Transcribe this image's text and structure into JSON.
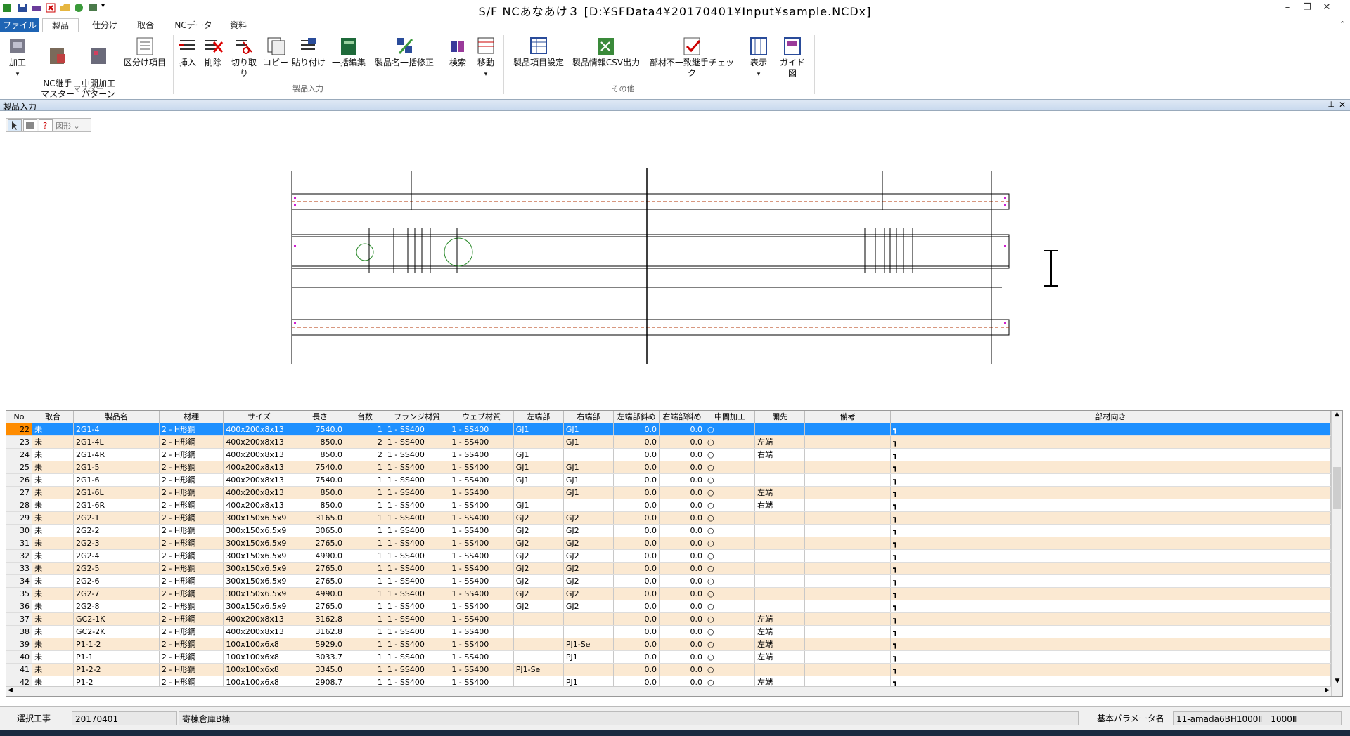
{
  "window": {
    "title": "S/F NCあなあけ３ [D:¥SFData4¥20170401¥Input¥sample.NCDx]"
  },
  "tabs": [
    {
      "label": "ファイル"
    },
    {
      "label": "製品"
    },
    {
      "label": "仕分け"
    },
    {
      "label": "取合"
    },
    {
      "label": "NCデータ"
    },
    {
      "label": "資料"
    }
  ],
  "ribbon": {
    "buttons": {
      "kako": "加工",
      "nc_tsugite": "NC継手\nマスター",
      "chukan": "中間加工\nパターン",
      "kubun": "区分け項目",
      "sounyu": "挿入",
      "sakujo": "削除",
      "kiritori": "切り取り",
      "copy": "コピー",
      "haritsuke": "貼り付け",
      "ikkatsu": "一括編集",
      "seihinmei": "製品名一括修正",
      "kensaku": "検索",
      "idou": "移動",
      "koumoku": "製品項目設定",
      "csv": "製品情報CSV出力",
      "buzai": "部材不一致継手チェック",
      "hyouji": "表示",
      "guide": "ガイド図"
    },
    "groups": {
      "master": "マスター",
      "seihin_nyuryoku": "製品入力",
      "sonota": "その他"
    }
  },
  "panel": {
    "title": "製品入力",
    "shape_dropdown": "図形"
  },
  "table": {
    "headers": [
      "No",
      "取合",
      "製品名",
      "材種",
      "サイズ",
      "長さ",
      "台数",
      "フランジ材質",
      "ウェブ材質",
      "左端部",
      "右端部",
      "左端部斜め",
      "右端部斜め",
      "中間加工",
      "開先",
      "備考",
      "部材向き"
    ],
    "rows": [
      [
        "22",
        "未",
        "2G1-4",
        "2 - H形鋼",
        "400x200x8x13",
        "7540.0",
        "1",
        "1 - SS400",
        "1 - SS400",
        "GJ1",
        "GJ1",
        "0.0",
        "0.0",
        "○",
        "",
        "",
        "┓"
      ],
      [
        "23",
        "未",
        "2G1-4L",
        "2 - H形鋼",
        "400x200x8x13",
        "850.0",
        "2",
        "1 - SS400",
        "1 - SS400",
        "",
        "GJ1",
        "0.0",
        "0.0",
        "○",
        "左端",
        "",
        "┓"
      ],
      [
        "24",
        "未",
        "2G1-4R",
        "2 - H形鋼",
        "400x200x8x13",
        "850.0",
        "2",
        "1 - SS400",
        "1 - SS400",
        "GJ1",
        "",
        "0.0",
        "0.0",
        "○",
        "右端",
        "",
        "┓"
      ],
      [
        "25",
        "未",
        "2G1-5",
        "2 - H形鋼",
        "400x200x8x13",
        "7540.0",
        "1",
        "1 - SS400",
        "1 - SS400",
        "GJ1",
        "GJ1",
        "0.0",
        "0.0",
        "○",
        "",
        "",
        "┓"
      ],
      [
        "26",
        "未",
        "2G1-6",
        "2 - H形鋼",
        "400x200x8x13",
        "7540.0",
        "1",
        "1 - SS400",
        "1 - SS400",
        "GJ1",
        "GJ1",
        "0.0",
        "0.0",
        "○",
        "",
        "",
        "┓"
      ],
      [
        "27",
        "未",
        "2G1-6L",
        "2 - H形鋼",
        "400x200x8x13",
        "850.0",
        "1",
        "1 - SS400",
        "1 - SS400",
        "",
        "GJ1",
        "0.0",
        "0.0",
        "○",
        "左端",
        "",
        "┓"
      ],
      [
        "28",
        "未",
        "2G1-6R",
        "2 - H形鋼",
        "400x200x8x13",
        "850.0",
        "1",
        "1 - SS400",
        "1 - SS400",
        "GJ1",
        "",
        "0.0",
        "0.0",
        "○",
        "右端",
        "",
        "┓"
      ],
      [
        "29",
        "未",
        "2G2-1",
        "2 - H形鋼",
        "300x150x6.5x9",
        "3165.0",
        "1",
        "1 - SS400",
        "1 - SS400",
        "GJ2",
        "GJ2",
        "0.0",
        "0.0",
        "○",
        "",
        "",
        "┓"
      ],
      [
        "30",
        "未",
        "2G2-2",
        "2 - H形鋼",
        "300x150x6.5x9",
        "3065.0",
        "1",
        "1 - SS400",
        "1 - SS400",
        "GJ2",
        "GJ2",
        "0.0",
        "0.0",
        "○",
        "",
        "",
        "┓"
      ],
      [
        "31",
        "未",
        "2G2-3",
        "2 - H形鋼",
        "300x150x6.5x9",
        "2765.0",
        "1",
        "1 - SS400",
        "1 - SS400",
        "GJ2",
        "GJ2",
        "0.0",
        "0.0",
        "○",
        "",
        "",
        "┓"
      ],
      [
        "32",
        "未",
        "2G2-4",
        "2 - H形鋼",
        "300x150x6.5x9",
        "4990.0",
        "1",
        "1 - SS400",
        "1 - SS400",
        "GJ2",
        "GJ2",
        "0.0",
        "0.0",
        "○",
        "",
        "",
        "┓"
      ],
      [
        "33",
        "未",
        "2G2-5",
        "2 - H形鋼",
        "300x150x6.5x9",
        "2765.0",
        "1",
        "1 - SS400",
        "1 - SS400",
        "GJ2",
        "GJ2",
        "0.0",
        "0.0",
        "○",
        "",
        "",
        "┓"
      ],
      [
        "34",
        "未",
        "2G2-6",
        "2 - H形鋼",
        "300x150x6.5x9",
        "2765.0",
        "1",
        "1 - SS400",
        "1 - SS400",
        "GJ2",
        "GJ2",
        "0.0",
        "0.0",
        "○",
        "",
        "",
        "┓"
      ],
      [
        "35",
        "未",
        "2G2-7",
        "2 - H形鋼",
        "300x150x6.5x9",
        "4990.0",
        "1",
        "1 - SS400",
        "1 - SS400",
        "GJ2",
        "GJ2",
        "0.0",
        "0.0",
        "○",
        "",
        "",
        "┓"
      ],
      [
        "36",
        "未",
        "2G2-8",
        "2 - H形鋼",
        "300x150x6.5x9",
        "2765.0",
        "1",
        "1 - SS400",
        "1 - SS400",
        "GJ2",
        "GJ2",
        "0.0",
        "0.0",
        "○",
        "",
        "",
        "┓"
      ],
      [
        "37",
        "未",
        "GC2-1K",
        "2 - H形鋼",
        "400x200x8x13",
        "3162.8",
        "1",
        "1 - SS400",
        "1 - SS400",
        "",
        "",
        "0.0",
        "0.0",
        "○",
        "左端",
        "",
        "┓"
      ],
      [
        "38",
        "未",
        "GC2-2K",
        "2 - H形鋼",
        "400x200x8x13",
        "3162.8",
        "1",
        "1 - SS400",
        "1 - SS400",
        "",
        "",
        "0.0",
        "0.0",
        "○",
        "左端",
        "",
        "┓"
      ],
      [
        "39",
        "未",
        "P1-1-2",
        "2 - H形鋼",
        "100x100x6x8",
        "5929.0",
        "1",
        "1 - SS400",
        "1 - SS400",
        "",
        "PJ1-Se",
        "0.0",
        "0.0",
        "○",
        "左端",
        "",
        "┓"
      ],
      [
        "40",
        "未",
        "P1-1",
        "2 - H形鋼",
        "100x100x6x8",
        "3033.7",
        "1",
        "1 - SS400",
        "1 - SS400",
        "",
        "PJ1",
        "0.0",
        "0.0",
        "○",
        "左端",
        "",
        "┓"
      ],
      [
        "41",
        "未",
        "P1-2-2",
        "2 - H形鋼",
        "100x100x6x8",
        "3345.0",
        "1",
        "1 - SS400",
        "1 - SS400",
        "PJ1-Se",
        "",
        "0.0",
        "0.0",
        "○",
        "",
        "",
        "┓"
      ],
      [
        "42",
        "未",
        "P1-2",
        "2 - H形鋼",
        "100x100x6x8",
        "2908.7",
        "1",
        "1 - SS400",
        "1 - SS400",
        "",
        "PJ1",
        "0.0",
        "0.0",
        "○",
        "左端",
        "",
        "┓"
      ]
    ]
  },
  "status": {
    "label_project": "選択工事",
    "project_code": "20170401",
    "project_name": "寄棟倉庫B棟",
    "label_param": "基本パラメータ名",
    "param_value": "11-amada6BH1000Ⅱ　1000Ⅲ"
  },
  "colors": {
    "selected_row": "#1e90ff",
    "selected_no": "#ff8c00",
    "even_row": "#fbe9d2",
    "file_tab": "#1e64b4"
  }
}
